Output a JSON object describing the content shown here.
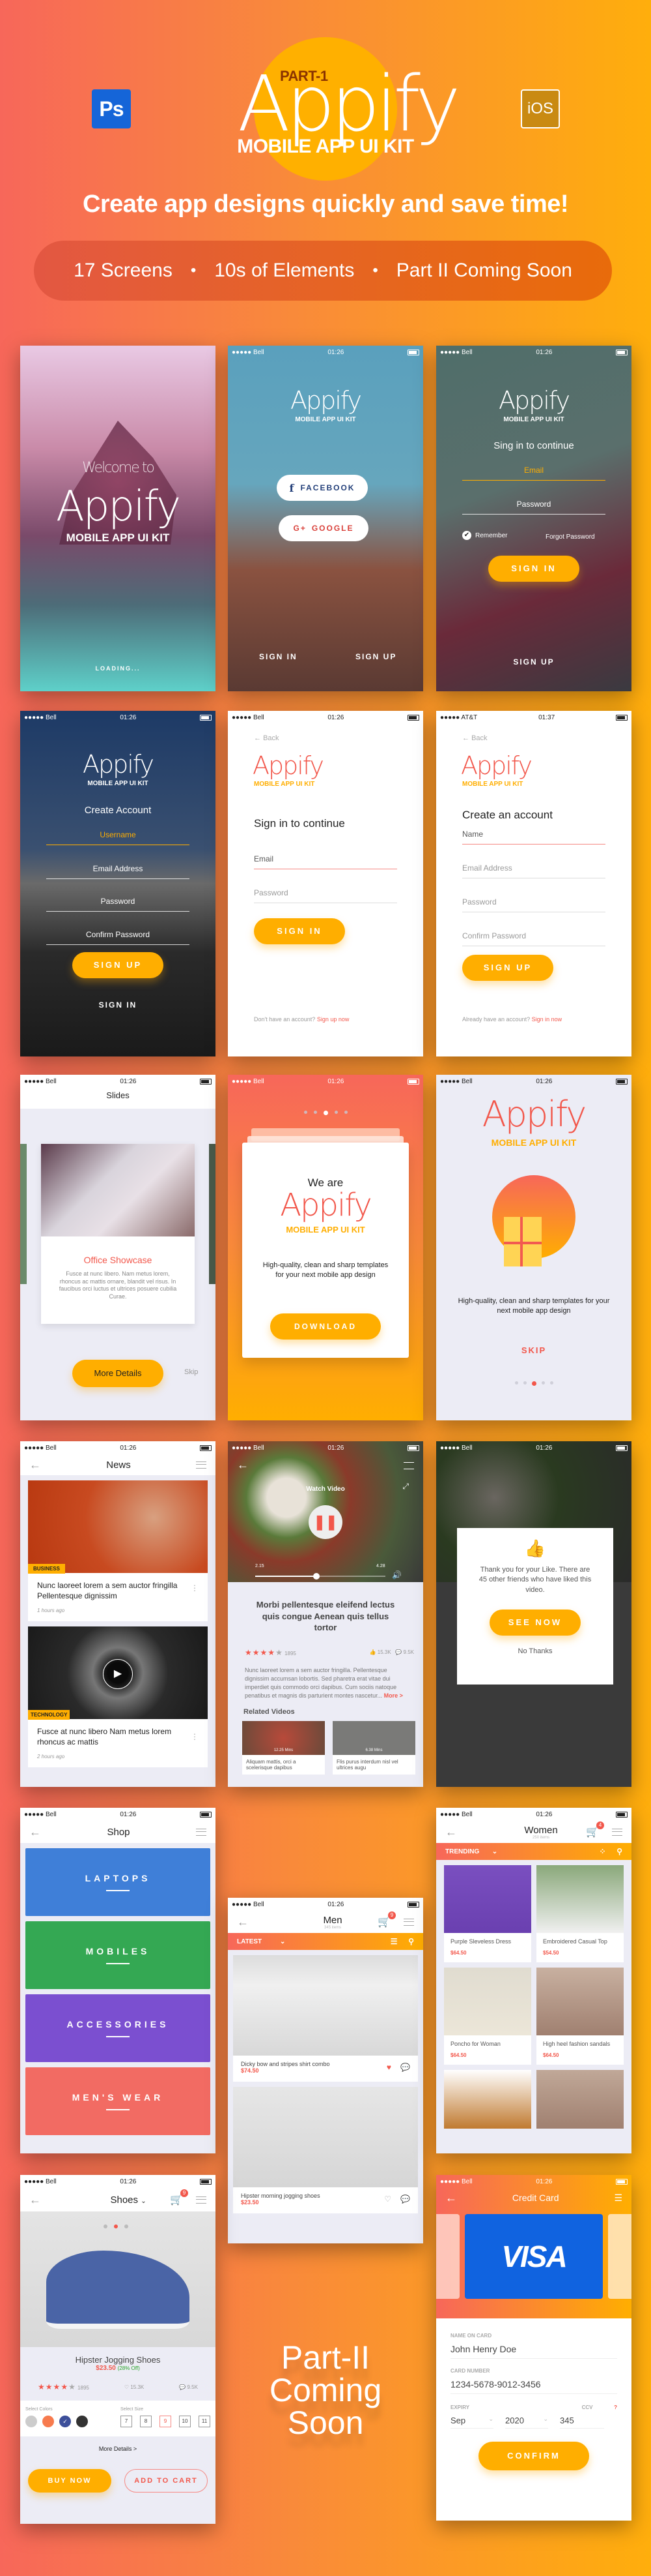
{
  "header": {
    "ps_badge": "Ps",
    "ios_badge": "iOS",
    "part_label": "PART-1",
    "brand": "Appify",
    "subtitle": "MOBILE APP UI KIT",
    "tagline": "Create app designs quickly and save time!",
    "features": [
      "17 Screens",
      "10s of Elements",
      "Part II Coming Soon"
    ],
    "bullet": "•"
  },
  "status": {
    "carrier": "●●●●● Bell",
    "carrier_att": "●●●●● AT&T",
    "time": "01:26",
    "time_alt": "01:37"
  },
  "screens": {
    "splash": {
      "welcome": "Welcome to",
      "brand": "Appify",
      "kit": "MOBILE APP UI KIT",
      "loading": "LOADING..."
    },
    "social": {
      "brand": "Appify",
      "kit": "MOBILE APP UI KIT",
      "facebook": "FACEBOOK",
      "facebook_icon": "f",
      "google": "GOOGLE",
      "google_icon": "G+",
      "sign_in": "SIGN IN",
      "sign_up": "SIGN UP"
    },
    "signin_dark": {
      "brand": "Appify",
      "kit": "MOBILE APP UI KIT",
      "heading": "Sing in to continue",
      "email": "Email",
      "password": "Password",
      "remember": "Remember",
      "forgot": "Forgot Password",
      "sign_in": "SIGN IN",
      "sign_up": "SIGN UP"
    },
    "signup_dark": {
      "brand": "Appify",
      "kit": "MOBILE APP UI KIT",
      "heading": "Create Account",
      "username": "Username",
      "email": "Email Address",
      "password": "Password",
      "confirm": "Confirm Password",
      "sign_up": "SIGN UP",
      "sign_in": "SIGN IN"
    },
    "signin_light": {
      "back": "Back",
      "brand": "Appify",
      "kit": "MOBILE APP UI KIT",
      "heading": "Sign in to continue",
      "email": "Email",
      "password": "Password",
      "sign_in": "SIGN IN",
      "footer": "Don't have an account?",
      "footer_link": "Sign up now"
    },
    "signup_light": {
      "back": "Back",
      "brand": "Appify",
      "kit": "MOBILE APP UI KIT",
      "heading": "Create an account",
      "name": "Name",
      "email": "Email Address",
      "password": "Password",
      "confirm": "Confirm Password",
      "sign_up": "SIGN UP",
      "footer": "Already have an account?",
      "footer_link": "Sign in now"
    },
    "slides": {
      "title": "Slides",
      "card_title": "Office Showcase",
      "card_text": "Fusce at nunc libero. Nam metus lorem, rhoncus ac mattis ornare, blandit vel risus. In faucibus orci luctus et ultrices posuere cubilia Curae.",
      "more": "More Details",
      "skip": "Skip"
    },
    "download": {
      "we_are": "We are",
      "brand": "Appify",
      "kit": "MOBILE APP UI KIT",
      "desc": "High-quality, clean and sharp templates for your next mobile app design",
      "download": "DOWNLOAD",
      "active_dot": 3,
      "dots": 5
    },
    "gift": {
      "brand": "Appify",
      "kit": "MOBILE APP UI KIT",
      "desc": "High-quality, clean and sharp templates for your next mobile app design",
      "skip": "SKIP",
      "active_dot": 3,
      "dots": 5
    },
    "news": {
      "title": "News",
      "items": [
        {
          "tag": "BUSINESS",
          "title": "Nunc laoreet lorem a sem auctor fringilla Pellentesque dignissim",
          "time": "1 hours ago"
        },
        {
          "tag": "TECHNOLOGY",
          "title": "Fusce at nunc libero Nam metus lorem rhoncus ac mattis",
          "time": "2 hours ago"
        }
      ]
    },
    "video": {
      "watch": "Watch Video",
      "elapsed": "2.15",
      "total": "4.28",
      "progress": 0.47,
      "title": "Morbi pellentesque eleifend lectus quis congue Aenean quis tellus tortor",
      "rating": 4,
      "rating_count": "1895",
      "likes": "15.3K",
      "comments": "9.5K",
      "body": "Nunc laoreet lorem a sem auctor fringilla. Pellentesque dignissim accumsan lobortis. Sed pharetra erat vitae dui imperdiet quis commodo orci dapibus. Cum sociis natoque penatibus et magnis dis parturient montes nascetur...",
      "more": "More >",
      "related_heading": "Related Videos",
      "related": [
        {
          "duration": "12.25 Mins",
          "title": "Aliquam mattis, orci a scelerisque dapibus"
        },
        {
          "duration": "6.38 Mins",
          "title": "Flis purus interdum nisl vel ultrices augu"
        }
      ]
    },
    "like_dialog": {
      "message": "Thank you for your Like. There are 45 other friends who have liked this video.",
      "see_now": "SEE NOW",
      "no_thanks": "No Thanks"
    },
    "shop": {
      "title": "Shop",
      "categories": [
        {
          "label": "LAPTOPS",
          "color": "#3f7fd8"
        },
        {
          "label": "MOBILES",
          "color": "#34a853"
        },
        {
          "label": "ACCESSORIES",
          "color": "#7b4fd0"
        },
        {
          "label": "MEN'S WEAR",
          "color": "#f26b63"
        }
      ]
    },
    "men": {
      "title": "Men",
      "count": "345 items",
      "cart_count": "9",
      "filter": "LATEST",
      "products": [
        {
          "name": "Dicky bow and stripes shirt combo",
          "price": "$74.50",
          "liked": true
        },
        {
          "name": "Hipster morning jogging shoes",
          "price": "$23.50",
          "liked": false
        }
      ]
    },
    "women": {
      "title": "Women",
      "count": "250 items",
      "cart_count": "4",
      "filter": "TRENDING",
      "products": [
        {
          "name": "Purple Sleveless Dress",
          "price": "$64.50"
        },
        {
          "name": "Embroidered Casual Top",
          "price": "$54.50"
        },
        {
          "name": "Poncho for Woman",
          "price": "$64.50"
        },
        {
          "name": "High heel fashion sandals",
          "price": "$64.50"
        }
      ]
    },
    "shoes": {
      "title": "Shoes",
      "cart_count": "9",
      "name": "Hipster Jogging Shoes",
      "price": "$23.50",
      "discount": "(28% Off)",
      "rating": 4,
      "rating_count": "1895",
      "likes": "15.3K",
      "comments": "9.5K",
      "colors_label": "Select Colors",
      "colors": [
        "#cccccc",
        "#f77b4e",
        "#3d4f9a",
        "#333333"
      ],
      "selected_color": 2,
      "size_label": "Select Size",
      "sizes": [
        "7",
        "8",
        "9",
        "10",
        "11"
      ],
      "selected_size": "9",
      "more": "More Details >",
      "buy": "BUY NOW",
      "add": "ADD TO CART"
    },
    "coming": {
      "text1": "Part-II",
      "text2": "Coming",
      "text3": "Soon"
    },
    "credit": {
      "title": "Credit Card",
      "card_brand": "VISA",
      "name_label": "NAME ON CARD",
      "name": "John Henry Doe",
      "number_label": "CARD NUMBER",
      "number": "1234-5678-9012-3456",
      "expiry_label": "EXPIRY",
      "month": "Sep",
      "year": "2020",
      "ccv_label": "CCV",
      "ccv": "345",
      "help": "?",
      "confirm": "CONFIRM"
    }
  }
}
